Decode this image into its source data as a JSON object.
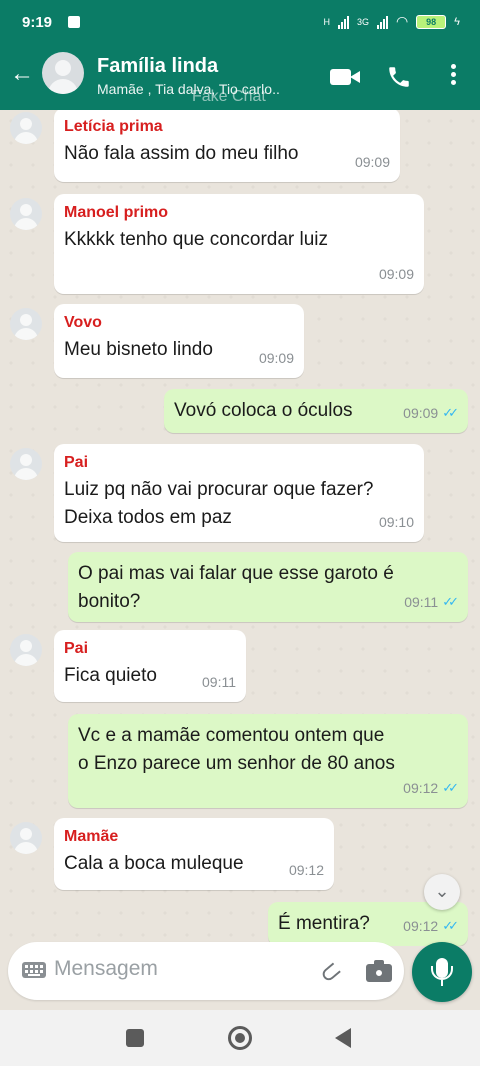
{
  "status_bar": {
    "time": "9:19",
    "network_1": "H",
    "network_2": "3G",
    "battery": "98"
  },
  "header": {
    "back_icon": "arrow-left-icon",
    "title": "Família linda",
    "subtitle": "Mamãe , Tia dalva, Tio carlo..",
    "watermark": "Fake Chat",
    "actions": [
      "video-call-icon",
      "phone-icon",
      "more-vertical-icon"
    ]
  },
  "colors": {
    "brand": "#0b7c66",
    "sender": "#d71f1f",
    "outgoing": "#dcf8c6",
    "read_ticks": "#34b7f1"
  },
  "messages": [
    {
      "dir": "in",
      "sender": "Letícia prima",
      "text": "Não fala assim do meu filho",
      "time": "09:09"
    },
    {
      "dir": "in",
      "sender": "Manoel primo",
      "text": "Kkkkk tenho que concordar luiz",
      "time": "09:09"
    },
    {
      "dir": "in",
      "sender": "Vovo",
      "text": "Meu bisneto lindo",
      "time": "09:09"
    },
    {
      "dir": "out",
      "text": "Vovó coloca o óculos",
      "time": "09:09",
      "status": "read"
    },
    {
      "dir": "in",
      "sender": "Pai",
      "text": "Luiz pq não vai procurar oque fazer?\nDeixa todos em paz",
      "time": "09:10"
    },
    {
      "dir": "out",
      "text": "O pai mas vai falar que esse garoto é\nbonito?",
      "time": "09:11",
      "status": "read"
    },
    {
      "dir": "in",
      "sender": "Pai",
      "text": "Fica quieto",
      "time": "09:11"
    },
    {
      "dir": "out",
      "text": "Vc e a mamãe comentou ontem que\no Enzo parece  um senhor de 80 anos",
      "time": "09:12",
      "status": "read"
    },
    {
      "dir": "in",
      "sender": "Mamãe",
      "text": "Cala a boca muleque",
      "time": "09:12"
    },
    {
      "dir": "out",
      "text": "É mentira?",
      "time": "09:12",
      "status": "read"
    }
  ],
  "ticks_glyph": "✓✓",
  "scroll_down_glyph": "⌄",
  "composer": {
    "placeholder": "Mensagem",
    "icons": [
      "keyboard-icon",
      "attach-icon",
      "camera-icon",
      "mic-icon"
    ]
  },
  "navbar": {
    "icons": [
      "recent-apps-icon",
      "home-icon",
      "back-icon"
    ]
  }
}
